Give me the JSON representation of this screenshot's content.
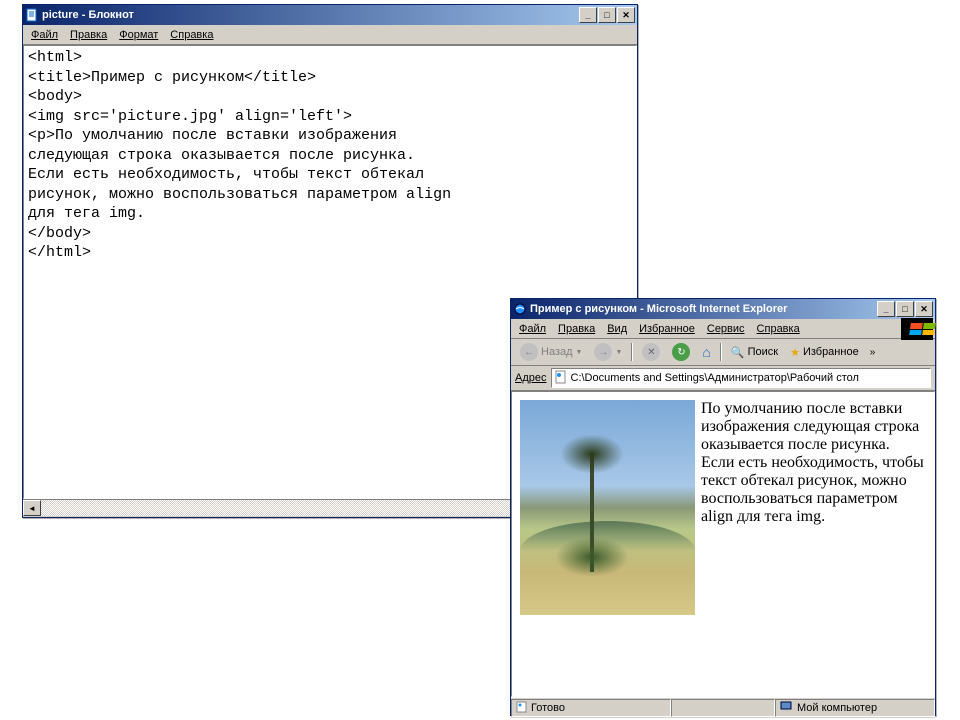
{
  "notepad": {
    "title": "picture - Блокнот",
    "menus": [
      "Файл",
      "Правка",
      "Формат",
      "Справка"
    ],
    "content": "<html>\n<title>Пример с рисунком</title>\n<body>\n<img src='picture.jpg' align='left'>\n<p>По умолчанию после вставки изображения\nследующая строка оказывается после рисунка.\nЕсли есть необходимость, чтобы текст обтекал\nрисунок, можно воспользоваться параметром align\nдля тега img.\n</body>\n</html>"
  },
  "ie": {
    "title": "Пример с рисунком - Microsoft Internet Explorer",
    "menus": [
      "Файл",
      "Правка",
      "Вид",
      "Избранное",
      "Сервис",
      "Справка"
    ],
    "toolbar": {
      "back": "Назад",
      "search": "Поиск",
      "favorites": "Избранное"
    },
    "address_label": "Адрес",
    "address_value": "C:\\Documents and Settings\\Администратор\\Рабочий стол",
    "body_text": "По умолчанию после вставки изображения следующая строка оказывается после рисунка. Если есть необходимость, чтобы текст обтекал рисунок, можно воспользоваться параметром align для тега img.",
    "status": "Готово",
    "status_zone": "Мой компьютер"
  }
}
